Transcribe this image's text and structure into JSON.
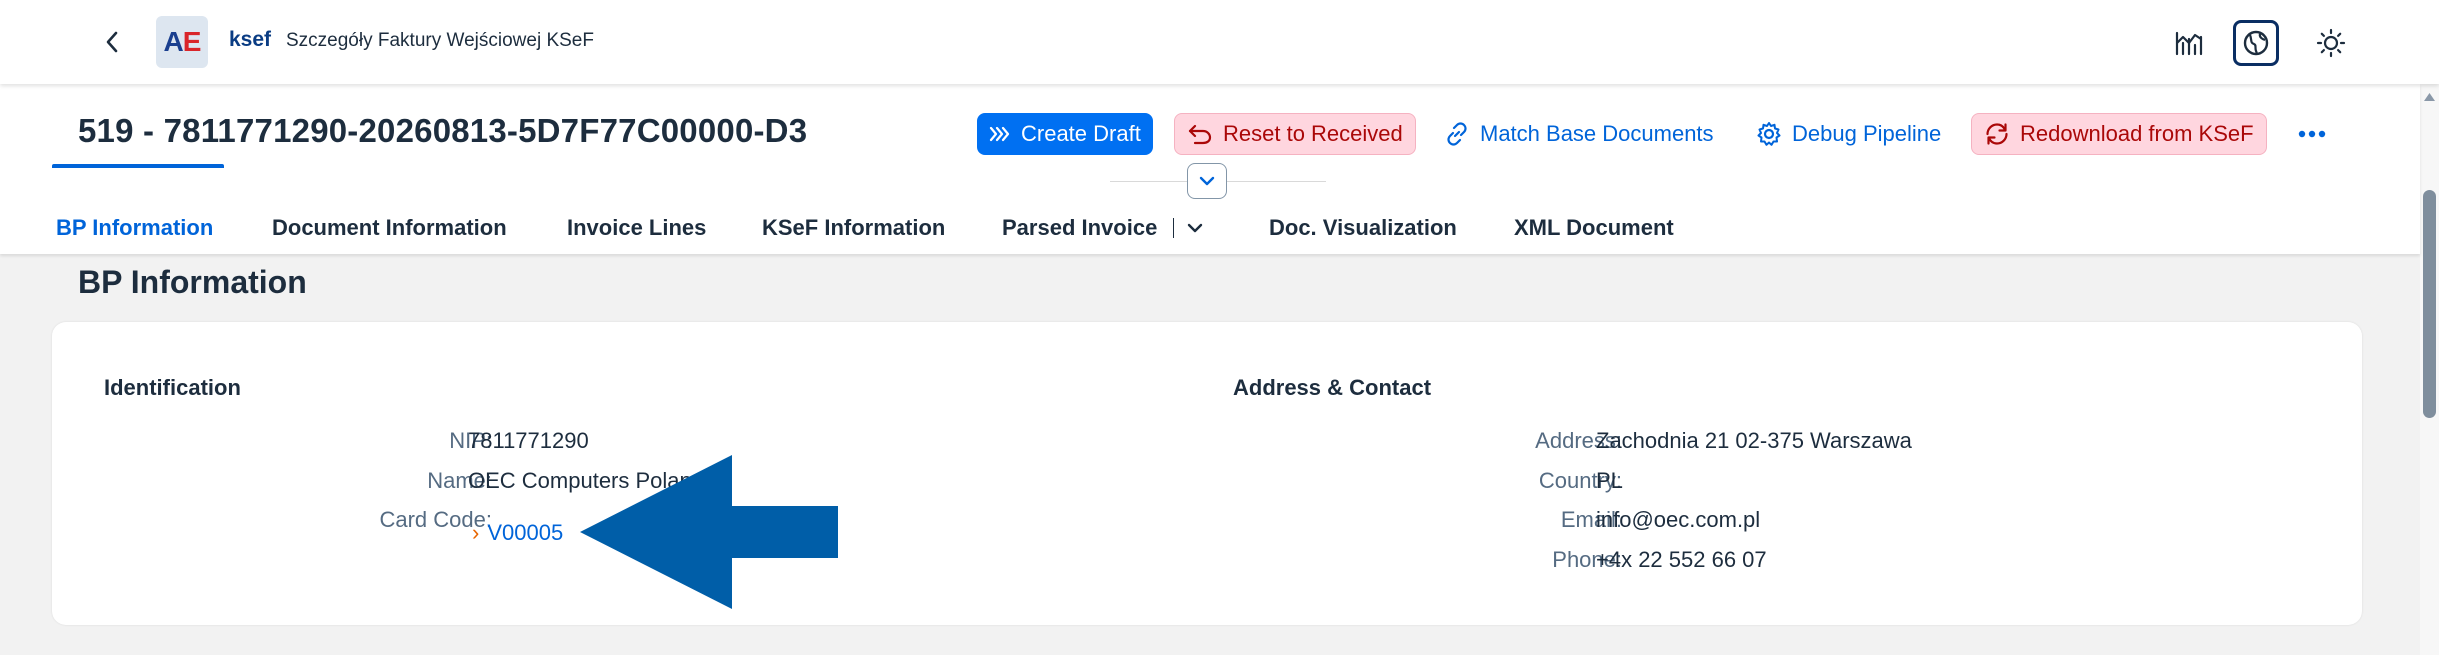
{
  "shell": {
    "logo_a": "A",
    "logo_e": "E",
    "product": "ksef",
    "title": "Szczegóły Faktury Wejściowej KSeF",
    "icons": [
      "chart-line-icon",
      "globe-icon",
      "sun-icon"
    ]
  },
  "header": {
    "object_title": "519 - 7811771290-20260813-5D7F77C00000-D3",
    "actions": {
      "create_draft": "Create Draft",
      "reset_received": "Reset to Received",
      "match_base": "Match Base Documents",
      "debug_pipeline": "Debug Pipeline",
      "redownload": "Redownload from KSeF"
    }
  },
  "tabs": [
    {
      "label": "BP Information",
      "active": true
    },
    {
      "label": "Document Information"
    },
    {
      "label": "Invoice Lines"
    },
    {
      "label": "KSeF Information"
    },
    {
      "label": "Parsed Invoice"
    },
    {
      "label": "Doc. Visualization"
    },
    {
      "label": "XML Document"
    }
  ],
  "section": {
    "title": "BP Information",
    "identification": {
      "title": "Identification",
      "nip_label": "NIP:",
      "nip_value": "7811771290",
      "name_label": "Name:",
      "name_value": "OEC Computers Poland",
      "card_code_label": "Card Code:",
      "card_code_value": "V00005"
    },
    "address_contact": {
      "title": "Address & Contact",
      "address_label": "Address:",
      "address_value": "Zachodnia 21 02-375 Warszawa",
      "country_label": "Country:",
      "country_value": "PL",
      "email_label": "Email:",
      "email_value": "info@oec.com.pl",
      "phone_label": "Phone:",
      "phone_value": "+4x 22 552 66 07"
    }
  },
  "colors": {
    "brand_blue": "#0064d9",
    "primary_button": "#0070f2",
    "danger_bg": "#ffd6df",
    "danger_text": "#aa0808",
    "annotation_arrow": "#005ea8"
  }
}
